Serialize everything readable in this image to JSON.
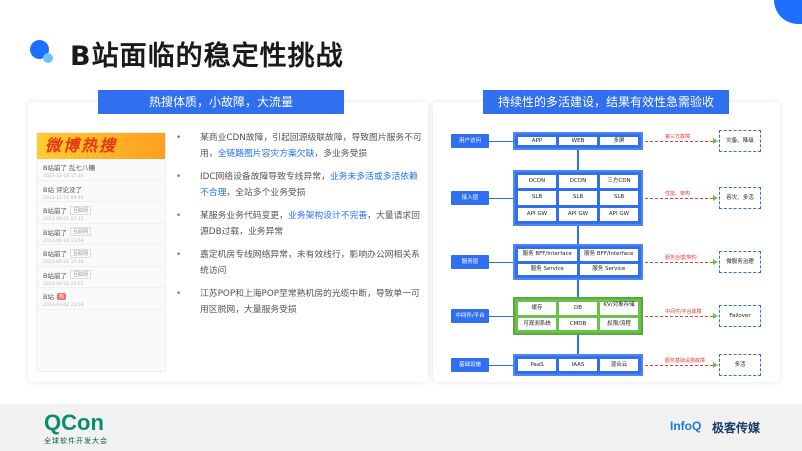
{
  "slide": {
    "title": "B站面临的稳定性挑战"
  },
  "left_panel": {
    "header": "热搜体质，小故障，大流量",
    "hot_search": {
      "banner": "微博热搜",
      "items": [
        {
          "text": "B站崩了 乱七八糟",
          "tag": "",
          "time": "2023-12-18 17:24"
        },
        {
          "text": "B站 评论没了",
          "tag": "",
          "time": "2023-12-16 09:44"
        },
        {
          "text": "B站崩了",
          "tag": "互联网",
          "time": "2023-08-05 07:22"
        },
        {
          "text": "B站崩了",
          "tag": "互联网",
          "time": "2023-06-24 13:59"
        },
        {
          "text": "B站崩了",
          "tag": "互联网",
          "time": "2023-05-26 15:48"
        },
        {
          "text": "B站崩了",
          "tag": "互联网",
          "time": "2023-04-21 22:52"
        },
        {
          "text": "B站",
          "tag": "热",
          "time": "2023-03-02 23:59"
        }
      ]
    },
    "bullets": [
      {
        "pre": "某商业CDN故障，引起回源级联故障，导致图片服务不可用，",
        "hl": "全链路图片容灾方案欠缺",
        "post": "，多业务受损"
      },
      {
        "pre": "IDC网络设备故障导致专线异常，",
        "hl": "业务未多活或多活依赖不合理",
        "post": "，全站多个业务受损"
      },
      {
        "pre": "某服务业务代码变更，",
        "hl": "业务架构设计不完善",
        "post": "，大量请求回源DB过载，业务异常"
      },
      {
        "pre": "嘉定机房专线网络异常，未有效线行，影响办公网相关系统访问",
        "hl": "",
        "post": ""
      },
      {
        "pre": "江苏POP和上海POP至常熟机房的光缆中断，导致单一可用区脱网，大量服务受损",
        "hl": "",
        "post": ""
      }
    ]
  },
  "right_panel": {
    "header": "持续性的多活建设，结果有效性急需验收",
    "layers": [
      {
        "label": "用户访问",
        "cells": [
          "APP",
          "WEB",
          "多屏"
        ],
        "annotation": "第三方故障",
        "outcome": "灾备、降级"
      },
      {
        "label": "接入层",
        "cells": [
          "DCDN",
          "DCDN",
          "三方CDN",
          "SLB",
          "SLB",
          "SLB",
          "API GW",
          "API GW",
          "API GW"
        ],
        "annotation": "性能、架构",
        "outcome": "容灾、多活"
      },
      {
        "label": "服务层",
        "cells": [
          "服务 BFF/Interface",
          "服务 BFF/Interface",
          "服务 Service",
          "服务 Service"
        ],
        "annotation": "服务治理/架构",
        "outcome": "微服务治理"
      },
      {
        "label": "中间件/平台",
        "cells": [
          "缓存",
          "DB",
          "KV/对象存储",
          "可观测系统",
          "CMDB",
          "权限/流程"
        ],
        "annotation": "中间件/平台故障",
        "outcome": "Failover"
      },
      {
        "label": "基础设施",
        "cells": [
          "PaaS",
          "IAAS",
          "混合云"
        ],
        "annotation": "服务基础设施故障",
        "outcome": "多活"
      }
    ]
  },
  "footer": {
    "qcon": "QCon",
    "qcon_sub": "全球软件开发大会",
    "infoq": "InfoQ",
    "geek": "极客传媒"
  },
  "colors": {
    "accent": "#2f6ff0",
    "green": "#6bc24a",
    "warning": "#e0403a"
  }
}
